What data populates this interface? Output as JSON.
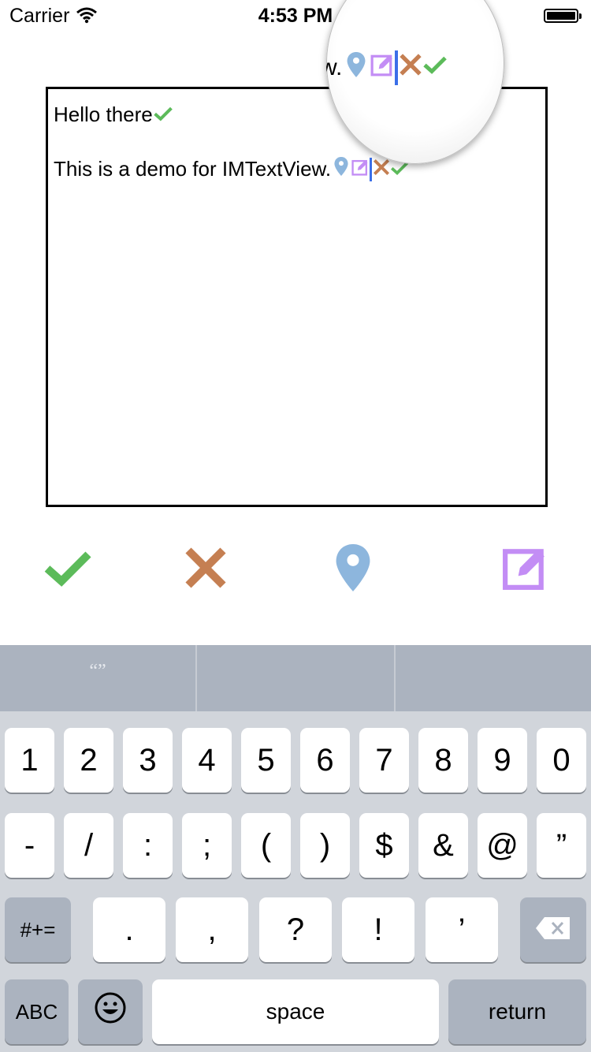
{
  "status_bar": {
    "carrier": "Carrier",
    "time": "4:53 PM"
  },
  "text_view": {
    "line1": "Hello there",
    "line2": "This is a demo for IMTextView."
  },
  "magnifier": {
    "text": "w."
  },
  "emoji_toolbar": {
    "items": [
      "checkmark",
      "cross",
      "map-pin",
      "edit"
    ]
  },
  "keyboard": {
    "suggestion": "“”",
    "row1": [
      "1",
      "2",
      "3",
      "4",
      "5",
      "6",
      "7",
      "8",
      "9",
      "0"
    ],
    "row2": [
      "-",
      "/",
      ":",
      ";",
      "(",
      ")",
      "$",
      "&",
      "@",
      "”"
    ],
    "row3": {
      "shift": "#+=",
      "keys": [
        ".",
        ",",
        "?",
        "!",
        "’"
      ]
    },
    "row4": {
      "abc": "ABC",
      "space": "space",
      "return": "return"
    }
  },
  "colors": {
    "check": "#5cbb5a",
    "cross": "#c57f52",
    "pin": "#8db6dd",
    "edit": "#c38df5",
    "caret": "#3b6fe8"
  }
}
